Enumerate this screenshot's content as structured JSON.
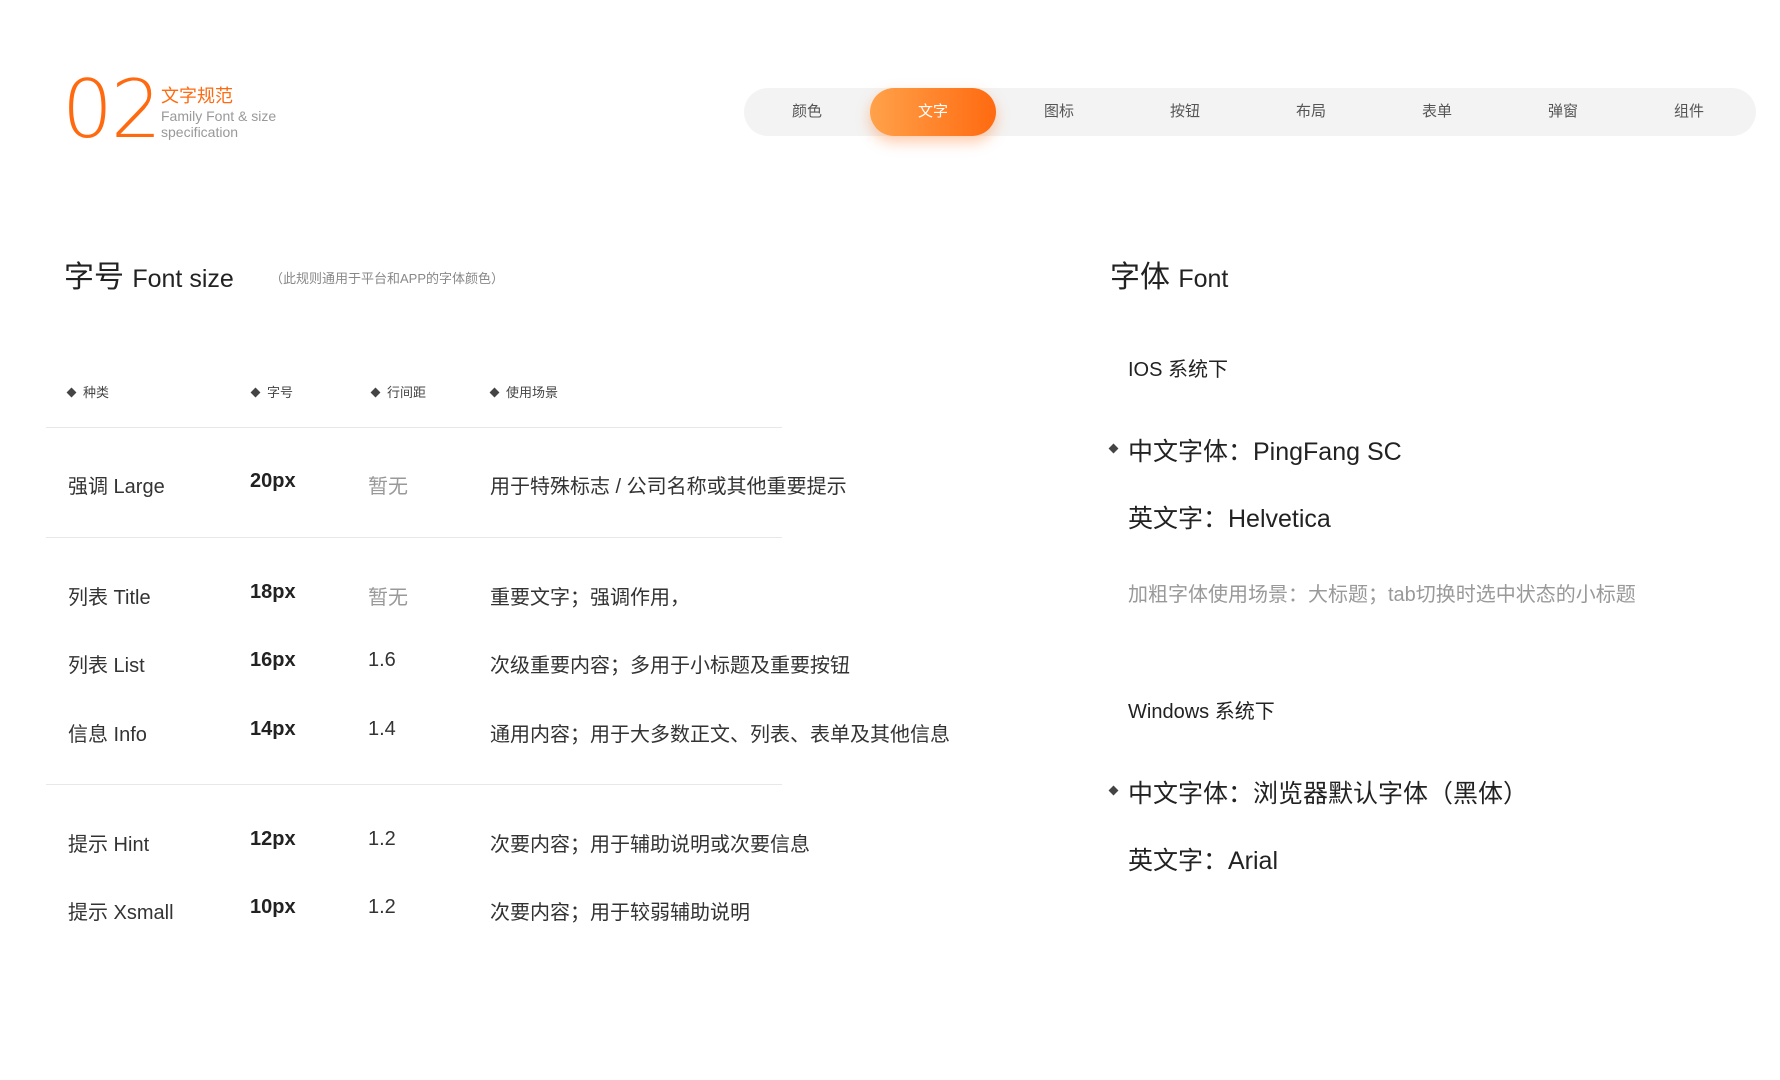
{
  "header": {
    "number": "02",
    "title": "文字规范",
    "subtitle": "Family Font & size specification"
  },
  "tabs": [
    {
      "label": "颜色",
      "active": false
    },
    {
      "label": "文字",
      "active": true
    },
    {
      "label": "图标",
      "active": false
    },
    {
      "label": "按钮",
      "active": false
    },
    {
      "label": "布局",
      "active": false
    },
    {
      "label": "表单",
      "active": false
    },
    {
      "label": "弹窗",
      "active": false
    },
    {
      "label": "组件",
      "active": false
    }
  ],
  "font_size": {
    "title_cn": "字号",
    "title_en": "Font size",
    "note": "（此规则通用于平台和APP的字体颜色）",
    "columns": [
      "种类",
      "字号",
      "行间距",
      "使用场景"
    ],
    "rows": [
      {
        "type": "强调 Large",
        "size": "20px",
        "line_height": "暂无",
        "usage": "用于特殊标志 / 公司名称或其他重要提示"
      },
      {
        "type": "列表 Title",
        "size": "18px",
        "line_height": "暂无",
        "usage": "重要文字；强调作用，"
      },
      {
        "type": "列表 List",
        "size": "16px",
        "line_height": "1.6",
        "usage": "次级重要内容；多用于小标题及重要按钮"
      },
      {
        "type": "信息 Info",
        "size": "14px",
        "line_height": "1.4",
        "usage": "通用内容；用于大多数正文、列表、表单及其他信息"
      },
      {
        "type": "提示 Hint",
        "size": "12px",
        "line_height": "1.2",
        "usage": "次要内容；用于辅助说明或次要信息"
      },
      {
        "type": "提示 Xsmall",
        "size": "10px",
        "line_height": "1.2",
        "usage": "次要内容；用于较弱辅助说明"
      }
    ]
  },
  "font": {
    "title_cn": "字体",
    "title_en": "Font",
    "ios": {
      "label": "IOS 系统下",
      "cn_font": "中文字体：PingFang SC",
      "en_font": "英文字：Helvetica",
      "bold_note": "加粗字体使用场景：大标题；tab切换时选中状态的小标题"
    },
    "windows": {
      "label": "Windows 系统下",
      "cn_font": "中文字体：浏览器默认字体（黑体）",
      "en_font": "英文字：Arial"
    }
  },
  "colors": {
    "accent": "#ff6a10",
    "accent_light": "#ffa24a",
    "tabbar_bg": "#f3f3f3"
  }
}
